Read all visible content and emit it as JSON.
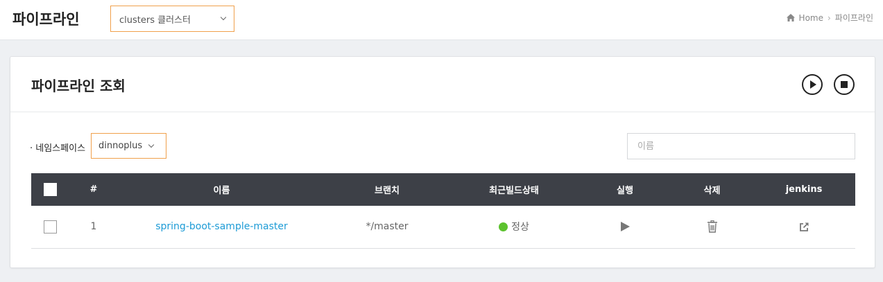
{
  "header": {
    "title": "파이프라인",
    "cluster_select": {
      "value": "clusters 클러스터"
    },
    "breadcrumb": {
      "home": "Home",
      "current": "파이프라인"
    }
  },
  "card": {
    "title": "파이프라인 조회",
    "namespace_label": "· 네임스페이스",
    "namespace_value": "dinnoplus",
    "search_placeholder": "이름"
  },
  "table": {
    "columns": [
      "#",
      "이름",
      "브랜치",
      "최근빌드상태",
      "실행",
      "삭제",
      "jenkins"
    ],
    "rows": [
      {
        "index": "1",
        "name": "spring-boot-sample-master",
        "branch": "*/master",
        "status": "정상"
      }
    ]
  },
  "colors": {
    "accent_border": "#f0a04b",
    "table_header": "#3d4047",
    "link": "#1d9bd6",
    "status_ok": "#5cc22e"
  },
  "icons": [
    "home-icon",
    "chevron-down-icon",
    "play-circle-icon",
    "stop-circle-icon",
    "play-icon",
    "trash-icon",
    "external-link-icon"
  ]
}
